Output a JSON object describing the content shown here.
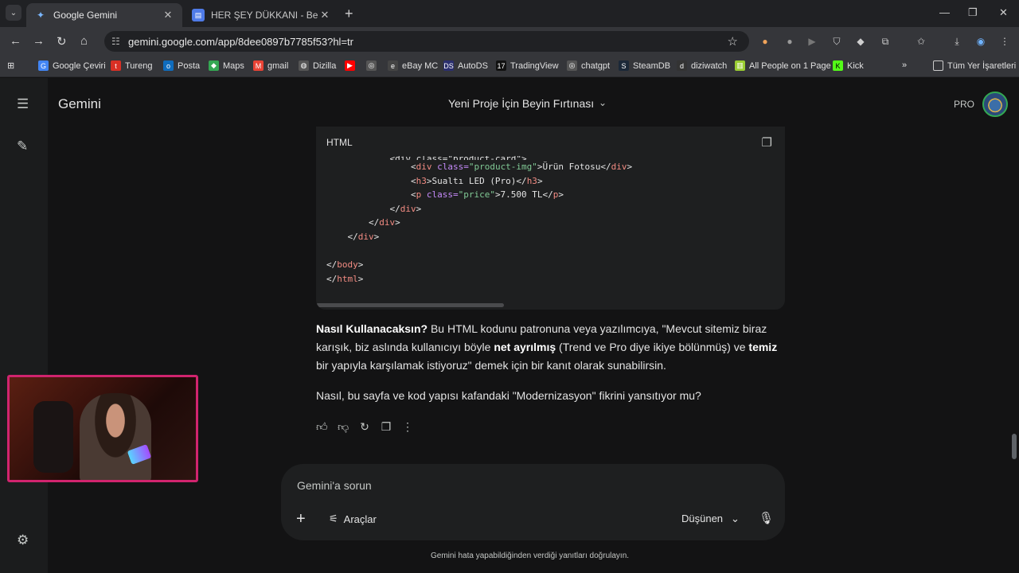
{
  "browser": {
    "tabs": [
      {
        "title": "Google Gemini",
        "active": true
      },
      {
        "title": "HER ŞEY DÜKKANI - Belge",
        "active": false
      }
    ],
    "url": "gemini.google.com/app/8dee0897b7785f53?hl=tr",
    "bookmarks": [
      "Google Çeviri",
      "Tureng",
      "Posta",
      "Maps",
      "gmail",
      "Dizilla",
      "eBay MC",
      "AutoDS",
      "TradingView",
      "chatgpt",
      "SteamDB",
      "diziwatch",
      "All People on 1 Page",
      "Kick"
    ],
    "all_bookmarks": "Tüm Yer İşaretleri"
  },
  "app": {
    "name": "Gemini",
    "conversation_title": "Yeni Proje İçin Beyin Fırtınası",
    "plan_badge": "PRO"
  },
  "code_block": {
    "language": "HTML",
    "clipped_first_line": "            <div class=\"product-card\">",
    "lines": [
      {
        "indent": "                ",
        "open": "<",
        "tag": "div",
        "attr": " class=",
        "str": "\"product-img\"",
        "text": ">Ürün Fotosu</",
        "close_tag": "div",
        "end": ">"
      },
      {
        "indent": "                ",
        "open": "<",
        "tag": "h3",
        "attr": "",
        "str": "",
        "text": ">Sualtı LED (Pro)</",
        "close_tag": "h3",
        "end": ">"
      },
      {
        "indent": "                ",
        "open": "<",
        "tag": "p",
        "attr": " class=",
        "str": "\"price\"",
        "text": ">7.500 TL</",
        "close_tag": "p",
        "end": ">"
      },
      {
        "indent": "            ",
        "open": "</",
        "tag": "div",
        "attr": "",
        "str": "",
        "text": ">",
        "close_tag": "",
        "end": ""
      },
      {
        "indent": "        ",
        "open": "</",
        "tag": "div",
        "attr": "",
        "str": "",
        "text": ">",
        "close_tag": "",
        "end": ""
      },
      {
        "indent": "    ",
        "open": "</",
        "tag": "div",
        "attr": "",
        "str": "",
        "text": ">",
        "close_tag": "",
        "end": ""
      },
      {
        "indent": "",
        "open": "",
        "tag": "",
        "attr": "",
        "str": "",
        "text": "",
        "close_tag": "",
        "end": ""
      },
      {
        "indent": "",
        "open": "</",
        "tag": "body",
        "attr": "",
        "str": "",
        "text": ">",
        "close_tag": "",
        "end": ""
      },
      {
        "indent": "",
        "open": "</",
        "tag": "html",
        "attr": "",
        "str": "",
        "text": ">",
        "close_tag": "",
        "end": ""
      }
    ]
  },
  "response": {
    "p1_b1": "Nasıl Kullanacaksın?",
    "p1_t1": " Bu HTML kodunu patronuna veya yazılımcıya, \"Mevcut sitemiz biraz karışık, biz aslında kullanıcıyı böyle ",
    "p1_b2": "net ayrılmış",
    "p1_t2": " (Trend ve Pro diye ikiye bölünmüş) ve ",
    "p1_b3": "temiz",
    "p1_t3": " bir yapıyla karşılamak istiyoruz\" demek için bir kanıt olarak sunabilirsin.",
    "p2": "Nasıl, bu sayfa ve kod yapısı kafandaki \"Modernizasyon\" fikrini yansıtıyor mu?"
  },
  "composer": {
    "placeholder": "Gemini'a sorun",
    "tools_label": "Araçlar",
    "mode_label": "Düşünen"
  },
  "disclaimer": "Gemini hata yapabildiğinden verdiği yanıtları doğrulayın."
}
